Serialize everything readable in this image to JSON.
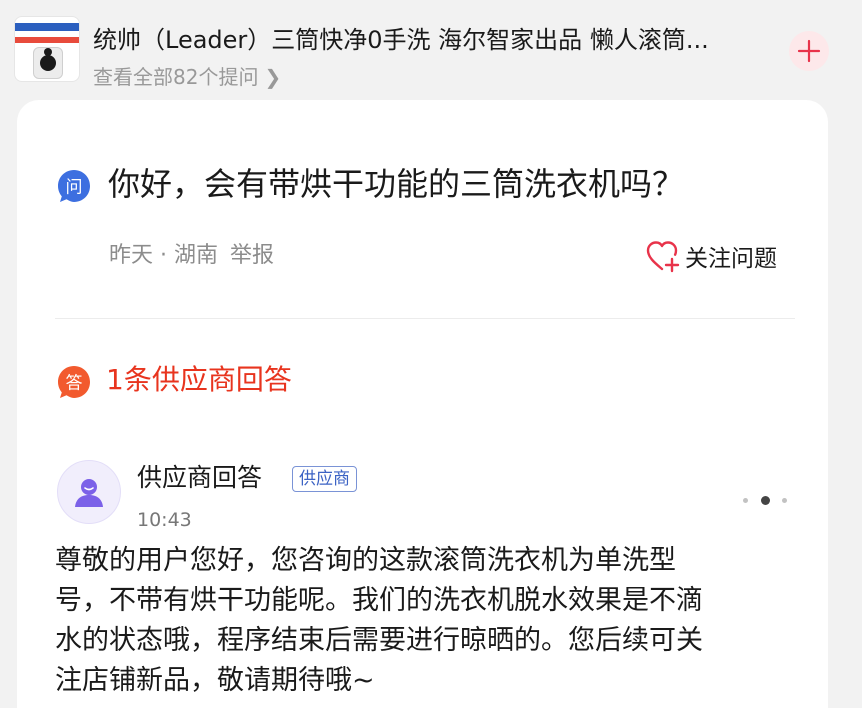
{
  "product": {
    "title": "统帅（Leader）三筒快净0手洗 海尔智家出品 懒人滚筒...",
    "view_all": "查看全部82个提问",
    "view_all_chevron": "❯"
  },
  "question": {
    "badge": "问",
    "text": "你好，会有带烘干功能的三筒洗衣机吗？",
    "meta": "昨天 · 湖南",
    "report": "举报",
    "follow_label": "关注问题"
  },
  "answers": {
    "badge": "答",
    "count_label": "1条供应商回答",
    "items": [
      {
        "author": "供应商回答",
        "tag": "供应商",
        "time": "10:43",
        "lines": [
          "尊敬的用户您好，您咨询的这款滚筒洗衣机为单洗型",
          "号，不带有烘干功能呢。",
          "我们的洗衣机脱水效果是不滴",
          "水的状态哦，程序结束后需要进行晾晒的。您后续可关",
          "注店铺新品，敬请期待哦~"
        ]
      }
    ]
  },
  "colors": {
    "accent_red": "#e8341e",
    "question_blue": "#3d6fe0",
    "underline_red": "#e0352b",
    "tag_blue": "#3c63c4"
  },
  "icons": {
    "add": "plus-icon",
    "follow": "heart-plus-icon",
    "avatar": "user-avatar-icon",
    "more": "more-dots-icon"
  }
}
